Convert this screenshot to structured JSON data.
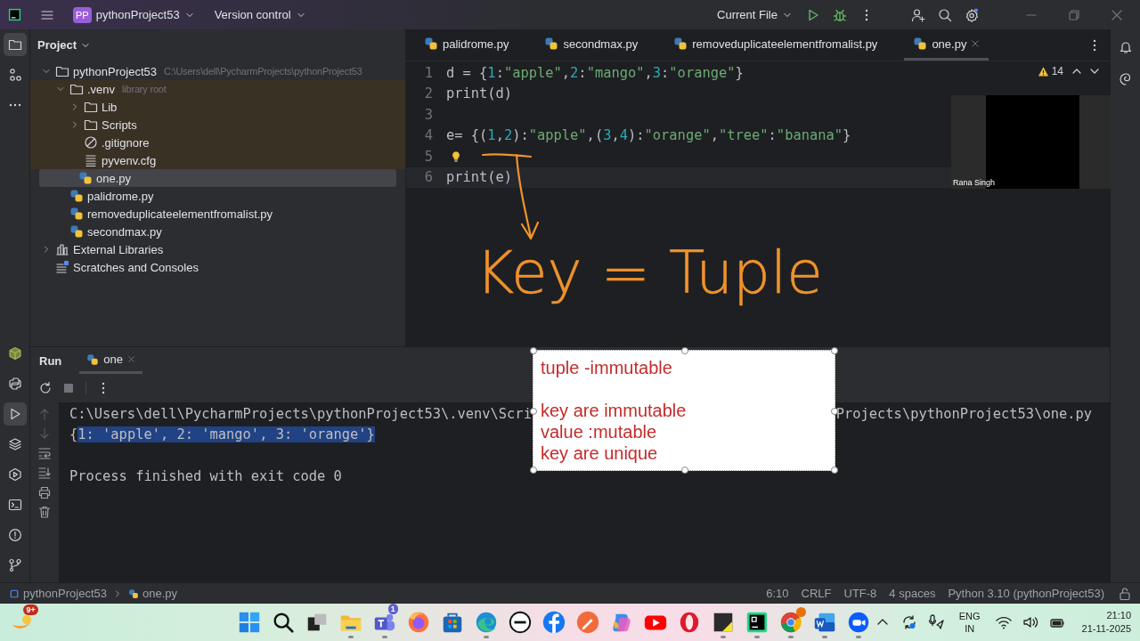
{
  "title_bar": {
    "project_badge": "PP",
    "project": "pythonProject53",
    "vcs": "Version control",
    "run_config": "Current File"
  },
  "tool_strip_left": {
    "top": [
      {
        "kind": "folder",
        "selected": true
      },
      {
        "kind": "structure",
        "selected": false
      },
      {
        "kind": "more",
        "selected": false
      }
    ],
    "bottom": [
      {
        "kind": "packages",
        "selected": false
      },
      {
        "kind": "console",
        "selected": false
      },
      {
        "kind": "run",
        "selected": true
      },
      {
        "kind": "layers",
        "selected": false
      },
      {
        "kind": "services",
        "selected": false
      },
      {
        "kind": "terminal",
        "selected": false
      },
      {
        "kind": "problems",
        "selected": false
      },
      {
        "kind": "git",
        "selected": false
      }
    ]
  },
  "project_panel": {
    "title": "Project",
    "tree": [
      {
        "label": "pythonProject53",
        "kind": "folder",
        "hint": "C:\\Users\\dell\\PycharmProjects\\pythonProject53",
        "expanded": true,
        "selected": false,
        "library": false,
        "children": [
          {
            "label": ".venv",
            "kind": "folder",
            "hint": "library root",
            "expanded": true,
            "selected": false,
            "library": true,
            "children": [
              {
                "label": "Lib",
                "kind": "folder",
                "expanded": false,
                "selected": false,
                "library": true
              },
              {
                "label": "Scripts",
                "kind": "folder",
                "expanded": false,
                "selected": false,
                "library": true
              },
              {
                "label": ".gitignore",
                "kind": "ignore",
                "selected": false,
                "library": true
              },
              {
                "label": "pyvenv.cfg",
                "kind": "config",
                "selected": false,
                "library": true
              }
            ]
          },
          {
            "label": "one.py",
            "kind": "python",
            "selected": true,
            "library": false
          },
          {
            "label": "palidrome.py",
            "kind": "python",
            "selected": false,
            "library": false
          },
          {
            "label": "removeduplicateelementfromalist.py",
            "kind": "python",
            "selected": false,
            "library": false
          },
          {
            "label": "secondmax.py",
            "kind": "python",
            "selected": false,
            "library": false
          }
        ]
      },
      {
        "label": "External Libraries",
        "kind": "library",
        "expanded": false,
        "selected": false,
        "library": false
      },
      {
        "label": "Scratches and Consoles",
        "kind": "scratches",
        "selected": false,
        "library": false
      }
    ]
  },
  "editor": {
    "tabs": [
      {
        "label": "palidrome.py",
        "selected": false
      },
      {
        "label": "secondmax.py",
        "selected": false
      },
      {
        "label": "removeduplicateelementfromalist.py",
        "selected": false
      },
      {
        "label": "one.py",
        "selected": true
      }
    ],
    "warnings": "14",
    "lines": [
      {
        "number": "1",
        "current": false,
        "tokens": [
          {
            "kind": "plain",
            "text": "d = {"
          },
          {
            "kind": "number",
            "text": "1"
          },
          {
            "kind": "plain",
            "text": ":"
          },
          {
            "kind": "string",
            "text": "\"apple\""
          },
          {
            "kind": "plain",
            "text": ","
          },
          {
            "kind": "number",
            "text": "2"
          },
          {
            "kind": "plain",
            "text": ":"
          },
          {
            "kind": "string",
            "text": "\"mango\""
          },
          {
            "kind": "plain",
            "text": ","
          },
          {
            "kind": "number",
            "text": "3"
          },
          {
            "kind": "plain",
            "text": ":"
          },
          {
            "kind": "string",
            "text": "\"orange\""
          },
          {
            "kind": "plain",
            "text": "}"
          }
        ]
      },
      {
        "number": "2",
        "current": false,
        "tokens": [
          {
            "kind": "plain",
            "text": "print(d)"
          }
        ]
      },
      {
        "number": "3",
        "current": false
      },
      {
        "number": "4",
        "current": false,
        "tokens": [
          {
            "kind": "plain",
            "text": "e= {("
          },
          {
            "kind": "number",
            "text": "1"
          },
          {
            "kind": "plain",
            "text": ","
          },
          {
            "kind": "number",
            "text": "2"
          },
          {
            "kind": "plain",
            "text": "):"
          },
          {
            "kind": "string",
            "text": "\"apple\""
          },
          {
            "kind": "plain",
            "text": ",("
          },
          {
            "kind": "number",
            "text": "3"
          },
          {
            "kind": "plain",
            "text": ","
          },
          {
            "kind": "number",
            "text": "4"
          },
          {
            "kind": "plain",
            "text": "):"
          },
          {
            "kind": "string",
            "text": "\"orange\""
          },
          {
            "kind": "plain",
            "text": ","
          },
          {
            "kind": "string",
            "text": "\"tree\""
          },
          {
            "kind": "plain",
            "text": ":"
          },
          {
            "kind": "string",
            "text": "\"banana\""
          },
          {
            "kind": "plain",
            "text": "}"
          }
        ]
      },
      {
        "number": "5",
        "current": false,
        "hint": true
      },
      {
        "number": "6",
        "current": true,
        "tokens": [
          {
            "kind": "plain",
            "text": "print(e)"
          }
        ]
      }
    ]
  },
  "video_tile": {
    "name": "Rana Singh"
  },
  "annotation": {
    "text": "Key = Tuple"
  },
  "text_box": {
    "paragraphs": [
      [
        "tuple -immutable"
      ],
      [
        "key are immutable",
        "value :mutable",
        "key are unique"
      ]
    ]
  },
  "run_panel": {
    "title": "Run",
    "tabs": [
      {
        "label": "one",
        "selected": true
      }
    ],
    "console": [
      {
        "kind": "cut",
        "start": "C:\\Users\\dell\\PycharmProjects\\pythonProject53\\.venv\\Scri",
        "end": "Projects\\pythonProject53\\one.py"
      },
      {
        "kind": "output",
        "segments": [
          {
            "text": "{",
            "selected": false
          },
          {
            "text": "1: 'apple', 2: 'mango', 3: 'orange'}",
            "selected": true
          }
        ]
      },
      {
        "kind": "status",
        "text": "Process finished with exit code 0"
      }
    ]
  },
  "status_bar": {
    "breadcrumbs": [
      "pythonProject53",
      "one.py"
    ],
    "items": [
      "6:10",
      "CRLF",
      "UTF-8",
      "4 spaces",
      "Python 3.10 (pythonProject53)"
    ]
  },
  "taskbar": {
    "widget_badge": "9+",
    "apps": [
      {
        "kind": "start",
        "running": false
      },
      {
        "kind": "search",
        "running": false
      },
      {
        "kind": "taskview",
        "running": false
      },
      {
        "kind": "explorer",
        "running": true
      },
      {
        "kind": "teams",
        "running": true,
        "badge": "1"
      },
      {
        "kind": "firefox",
        "running": false
      },
      {
        "kind": "store",
        "running": false
      },
      {
        "kind": "edge",
        "running": true
      },
      {
        "kind": "dell",
        "running": false
      },
      {
        "kind": "facebook",
        "running": false
      },
      {
        "kind": "draw",
        "running": false
      },
      {
        "kind": "copilot",
        "running": false
      },
      {
        "kind": "youtube",
        "running": false
      },
      {
        "kind": "opera",
        "running": false
      },
      {
        "kind": "notes",
        "running": true
      },
      {
        "kind": "pycharm",
        "running": true
      },
      {
        "kind": "chrome",
        "running": true
      },
      {
        "kind": "word",
        "running": true
      },
      {
        "kind": "zoom",
        "running": true
      }
    ],
    "tray": {
      "language": "ENG",
      "region": "IN",
      "time": "21:10",
      "date": "21-11-2025"
    }
  }
}
